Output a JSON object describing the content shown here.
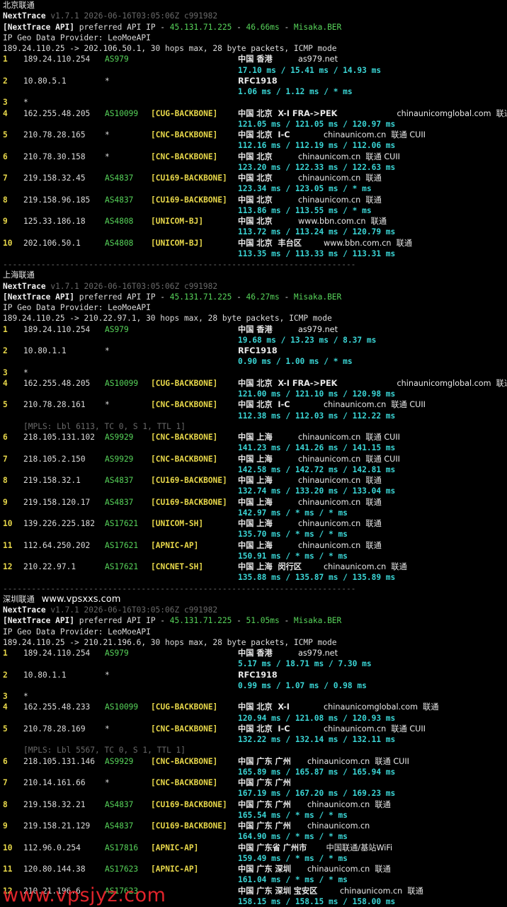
{
  "watermarks": {
    "top": "www.vpsxxs.com",
    "bottom": "www.vpsjyz.com"
  },
  "common": {
    "tool": "NextTrace",
    "version_line": " v1.7.1 2026-06-16T03:05:06Z c991982",
    "api_prefix": "[NextTrace API]",
    "api_mid": " preferred API IP - ",
    "api_ip": "45.131.71.225",
    "sep": " - ",
    "api_node": "Misaka.BER",
    "geo": "IP Geo Data Provider: LeoMoeAPI",
    "divider": "--------------------------------------------------------------------------"
  },
  "sections": [
    {
      "title": "北京联通",
      "api_latency": "46.66ms",
      "header": "189.24.110.25 -> 202.106.50.1, 30 hops max, 28 byte packets, ICMP mode",
      "divider": true,
      "rows": [
        {
          "hop": "1",
          "ip": "189.24.110.254",
          "asn": "AS979",
          "tag": "",
          "loc": "中国 香港",
          "extra": "as979.net",
          "rtt": "17.10 ms / 15.41 ms / 14.93 ms"
        },
        {
          "hop": "2",
          "ip": "10.80.5.1",
          "asn": "*",
          "tag": "",
          "loc": "RFC1918",
          "extra": "",
          "rtt": "1.06 ms / 1.12 ms / * ms"
        },
        {
          "hop": "3",
          "ip": "*",
          "asn": "",
          "tag": "",
          "loc": "",
          "extra": "",
          "rtt": ""
        },
        {
          "hop": "4",
          "ip": "162.255.48.205",
          "asn": "AS10099",
          "tag": "[CUG-BACKBONE]",
          "loc": "中国 北京  X-I FRA->PEK",
          "extra": "chinaunicomglobal.com  联通",
          "rtt": "121.05 ms / 121.05 ms / 120.97 ms"
        },
        {
          "hop": "5",
          "ip": "210.78.28.165",
          "asn": "*",
          "tag": "[CNC-BACKBONE]",
          "loc": "中国 北京  I-C",
          "extra": "chinaunicom.cn  联通 CUII",
          "rtt": "112.16 ms / 112.19 ms / 112.06 ms"
        },
        {
          "hop": "6",
          "ip": "210.78.30.158",
          "asn": "*",
          "tag": "[CNC-BACKBONE]",
          "loc": "中国 北京",
          "extra": "chinaunicom.cn  联通 CUII",
          "rtt": "123.20 ms / 122.33 ms / 122.63 ms"
        },
        {
          "hop": "7",
          "ip": "219.158.32.45",
          "asn": "AS4837",
          "tag": "[CU169-BACKBONE]",
          "loc": "中国 北京",
          "extra": "chinaunicom.cn  联通",
          "rtt": "123.34 ms / 123.05 ms / * ms"
        },
        {
          "hop": "8",
          "ip": "219.158.96.185",
          "asn": "AS4837",
          "tag": "[CU169-BACKBONE]",
          "loc": "中国 北京",
          "extra": "chinaunicom.cn  联通",
          "rtt": "113.86 ms / 113.55 ms / * ms"
        },
        {
          "hop": "9",
          "ip": "125.33.186.18",
          "asn": "AS4808",
          "tag": "[UNICOM-BJ]",
          "loc": "中国 北京",
          "extra": "www.bbn.com.cn  联通",
          "rtt": "113.72 ms / 113.24 ms / 120.79 ms"
        },
        {
          "hop": "10",
          "ip": "202.106.50.1",
          "asn": "AS4808",
          "tag": "[UNICOM-BJ]",
          "loc": "中国 北京  丰台区",
          "extra": "www.bbn.com.cn  联通",
          "rtt": "113.35 ms / 113.33 ms / 113.31 ms"
        }
      ]
    },
    {
      "title": "上海联通",
      "api_latency": "46.27ms",
      "header": "189.24.110.25 -> 210.22.97.1, 30 hops max, 28 byte packets, ICMP mode",
      "divider": true,
      "rows": [
        {
          "hop": "1",
          "ip": "189.24.110.254",
          "asn": "AS979",
          "tag": "",
          "loc": "中国 香港",
          "extra": "as979.net",
          "rtt": "19.68 ms / 13.23 ms / 8.37 ms"
        },
        {
          "hop": "2",
          "ip": "10.80.1.1",
          "asn": "*",
          "tag": "",
          "loc": "RFC1918",
          "extra": "",
          "rtt": "0.90 ms / 1.00 ms / * ms"
        },
        {
          "hop": "3",
          "ip": "*",
          "asn": "",
          "tag": "",
          "loc": "",
          "extra": "",
          "rtt": ""
        },
        {
          "hop": "4",
          "ip": "162.255.48.205",
          "asn": "AS10099",
          "tag": "[CUG-BACKBONE]",
          "loc": "中国 北京  X-I FRA->PEK",
          "extra": "chinaunicomglobal.com  联通",
          "rtt": "121.00 ms / 121.10 ms / 120.98 ms"
        },
        {
          "hop": "5",
          "ip": "210.78.28.161",
          "asn": "*",
          "tag": "[CNC-BACKBONE]",
          "loc": "中国 北京  I-C",
          "extra": "chinaunicom.cn  联通 CUII",
          "rtt": "112.38 ms / 112.03 ms / 112.22 ms"
        },
        {
          "hop": "6",
          "ip": "218.105.131.102",
          "asn": "AS9929",
          "tag": "[CNC-BACKBONE]",
          "loc": "中国 上海",
          "extra": "chinaunicom.cn  联通 CUII",
          "rtt": "141.23 ms / 141.26 ms / 141.15 ms",
          "mpls": "[MPLS: Lbl 6113, TC 0, S 1, TTL 1]"
        },
        {
          "hop": "7",
          "ip": "218.105.2.150",
          "asn": "AS9929",
          "tag": "[CNC-BACKBONE]",
          "loc": "中国 上海",
          "extra": "chinaunicom.cn  联通 CUII",
          "rtt": "142.58 ms / 142.72 ms / 142.81 ms"
        },
        {
          "hop": "8",
          "ip": "219.158.32.1",
          "asn": "AS4837",
          "tag": "[CU169-BACKBONE]",
          "loc": "中国 上海",
          "extra": "chinaunicom.cn  联通",
          "rtt": "132.74 ms / 133.20 ms / 133.04 ms"
        },
        {
          "hop": "9",
          "ip": "219.158.120.17",
          "asn": "AS4837",
          "tag": "[CU169-BACKBONE]",
          "loc": "中国 上海",
          "extra": "chinaunicom.cn  联通",
          "rtt": "142.97 ms / * ms / * ms"
        },
        {
          "hop": "10",
          "ip": "139.226.225.182",
          "asn": "AS17621",
          "tag": "[UNICOM-SH]",
          "loc": "中国 上海",
          "extra": "chinaunicom.cn  联通",
          "rtt": "135.70 ms / * ms / * ms"
        },
        {
          "hop": "11",
          "ip": "112.64.250.202",
          "asn": "AS17621",
          "tag": "[APNIC-AP]",
          "loc": "中国 上海",
          "extra": "chinaunicom.cn  联通",
          "rtt": "150.91 ms / * ms / * ms"
        },
        {
          "hop": "12",
          "ip": "210.22.97.1",
          "asn": "AS17621",
          "tag": "[CNCNET-SH]",
          "loc": "中国 上海  闵行区",
          "extra": "chinaunicom.cn  联通",
          "rtt": "135.88 ms / 135.87 ms / 135.89 ms"
        }
      ]
    },
    {
      "title": "深圳联通",
      "api_latency": "51.05ms",
      "header": "189.24.110.25 -> 210.21.196.6, 30 hops max, 28 byte packets, ICMP mode",
      "divider": false,
      "rows": [
        {
          "hop": "1",
          "ip": "189.24.110.254",
          "asn": "AS979",
          "tag": "",
          "loc": "中国 香港",
          "extra": "as979.net",
          "rtt": "5.17 ms / 18.71 ms / 7.30 ms"
        },
        {
          "hop": "2",
          "ip": "10.80.1.1",
          "asn": "*",
          "tag": "",
          "loc": "RFC1918",
          "extra": "",
          "rtt": "0.99 ms / 1.07 ms / 0.98 ms"
        },
        {
          "hop": "3",
          "ip": "*",
          "asn": "",
          "tag": "",
          "loc": "",
          "extra": "",
          "rtt": ""
        },
        {
          "hop": "4",
          "ip": "162.255.48.233",
          "asn": "AS10099",
          "tag": "[CUG-BACKBONE]",
          "loc": "中国 北京  X-I",
          "extra": "chinaunicomglobal.com  联通",
          "rtt": "120.94 ms / 121.08 ms / 120.93 ms"
        },
        {
          "hop": "5",
          "ip": "210.78.28.169",
          "asn": "*",
          "tag": "[CNC-BACKBONE]",
          "loc": "中国 北京  I-C",
          "extra": "chinaunicom.cn  联通 CUII",
          "rtt": "132.22 ms / 132.14 ms / 132.11 ms"
        },
        {
          "hop": "6",
          "ip": "218.105.131.146",
          "asn": "AS9929",
          "tag": "[CNC-BACKBONE]",
          "loc": "中国 广东 广州",
          "extra": "chinaunicom.cn  联通 CUII",
          "rtt": "165.89 ms / 165.87 ms / 165.94 ms",
          "mpls": "[MPLS: Lbl 5567, TC 0, S 1, TTL 1]"
        },
        {
          "hop": "7",
          "ip": "210.14.161.66",
          "asn": "*",
          "tag": "[CNC-BACKBONE]",
          "loc": "中国 广东 广州",
          "extra": "",
          "rtt": "167.19 ms / 167.20 ms / 169.23 ms"
        },
        {
          "hop": "8",
          "ip": "219.158.32.21",
          "asn": "AS4837",
          "tag": "[CU169-BACKBONE]",
          "loc": "中国 广东 广州",
          "extra": "chinaunicom.cn  联通",
          "rtt": "165.54 ms / * ms / * ms"
        },
        {
          "hop": "9",
          "ip": "219.158.21.129",
          "asn": "AS4837",
          "tag": "[CU169-BACKBONE]",
          "loc": "中国 广东 广州",
          "extra": "chinaunicom.cn",
          "rtt": "164.90 ms / * ms / * ms"
        },
        {
          "hop": "10",
          "ip": "112.96.0.254",
          "asn": "AS17816",
          "tag": "[APNIC-AP]",
          "loc": "中国 广东省 广州市",
          "extra": " 中国联通/基站WiFi",
          "rtt": "159.49 ms / * ms / * ms"
        },
        {
          "hop": "11",
          "ip": "120.80.144.38",
          "asn": "AS17623",
          "tag": "[APNIC-AP]",
          "loc": "中国 广东 深圳",
          "extra": "chinaunicom.cn  联通",
          "rtt": "161.04 ms / * ms / * ms"
        },
        {
          "hop": "12",
          "ip": "210.21.196.6",
          "asn": "AS17623",
          "tag": "",
          "loc": "中国 广东 深圳 宝安区",
          "extra": "chinaunicom.cn  联通",
          "rtt": "158.15 ms / 158.15 ms / 158.00 ms"
        }
      ]
    }
  ]
}
